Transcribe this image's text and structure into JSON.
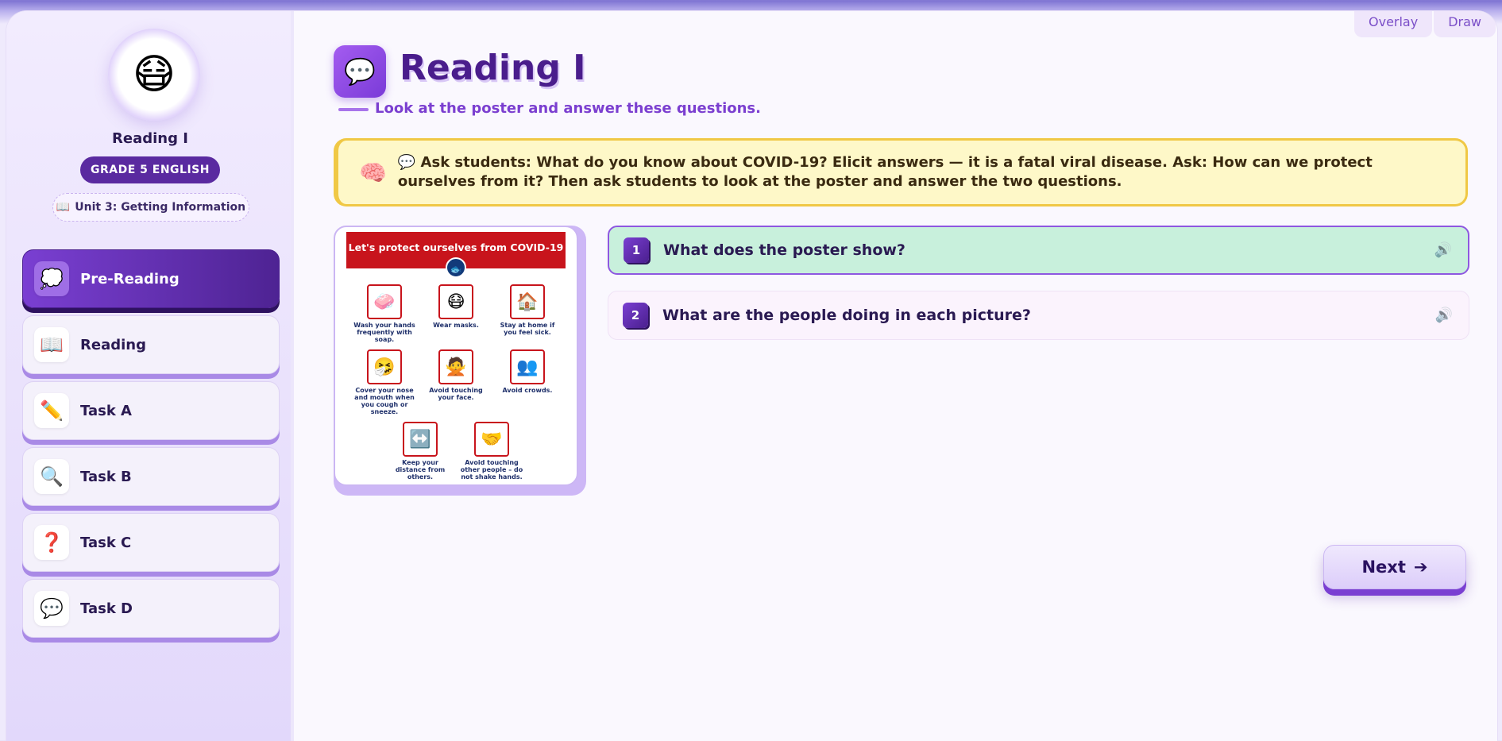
{
  "tools": {
    "overlay": "Overlay",
    "draw": "Draw"
  },
  "sidebar": {
    "avatar_emoji": "😷",
    "title": "Reading I",
    "grade": "GRADE 5 ENGLISH",
    "unit_icon": "📖",
    "unit": "Unit 3: Getting Information",
    "items": [
      {
        "icon": "💭",
        "label": "Pre-Reading",
        "active": true
      },
      {
        "icon": "📖",
        "label": "Reading"
      },
      {
        "icon": "✏️",
        "label": "Task A"
      },
      {
        "icon": "🔍",
        "label": "Task B"
      },
      {
        "icon": "❓",
        "label": "Task C"
      },
      {
        "icon": "💬",
        "label": "Task D"
      }
    ]
  },
  "header": {
    "icon": "💬",
    "title": "Reading I",
    "subtitle": "Look at the poster and answer these questions."
  },
  "note": {
    "icon": "🧠",
    "text": "💬 Ask students: What do you know about COVID-19? Elicit answers — it is a fatal viral disease. Ask: How can we protect ourselves from it? Then ask students to look at the poster and answer the two questions."
  },
  "poster": {
    "banner": "Let's protect ourselves from COVID-19",
    "cells": [
      {
        "icon": "🧼",
        "caption": "Wash your hands frequently with soap."
      },
      {
        "icon": "😷",
        "caption": "Wear masks."
      },
      {
        "icon": "🏠",
        "caption": "Stay at home if you feel sick."
      },
      {
        "icon": "🤧",
        "caption": "Cover your nose and mouth when you cough or sneeze."
      },
      {
        "icon": "🙅",
        "caption": "Avoid touching your face."
      },
      {
        "icon": "👥",
        "caption": "Avoid crowds."
      },
      {
        "icon": "↔️",
        "caption": "Keep your distance from others."
      },
      {
        "icon": "🤝",
        "caption": "Avoid touching other people – do not shake hands."
      }
    ]
  },
  "questions": [
    {
      "num": "1",
      "text": "What does the poster show?",
      "active": true
    },
    {
      "num": "2",
      "text": "What are the people doing in each picture?"
    }
  ],
  "next": {
    "label": "Next",
    "icon": "➔"
  }
}
